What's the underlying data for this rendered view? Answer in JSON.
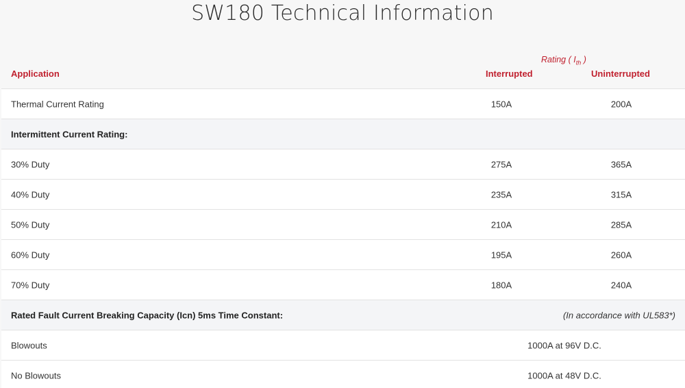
{
  "title": "SW180 Technical Information",
  "header": {
    "rating_prefix": "Rating ( I",
    "rating_sub": "th",
    "rating_suffix": " )",
    "application": "Application",
    "interrupted": "Interrupted",
    "uninterrupted": "Uninterrupted"
  },
  "rows": {
    "thermal": {
      "label": "Thermal Current Rating",
      "interrupted": "150A",
      "uninterrupted": "200A"
    },
    "intermittent_heading": "Intermittent Current Rating:",
    "duty30": {
      "label": "30% Duty",
      "interrupted": "275A",
      "uninterrupted": "365A"
    },
    "duty40": {
      "label": "40% Duty",
      "interrupted": "235A",
      "uninterrupted": "315A"
    },
    "duty50": {
      "label": "50% Duty",
      "interrupted": "210A",
      "uninterrupted": "285A"
    },
    "duty60": {
      "label": "60% Duty",
      "interrupted": "195A",
      "uninterrupted": "260A"
    },
    "duty70": {
      "label": "70% Duty",
      "interrupted": "180A",
      "uninterrupted": "240A"
    },
    "fault_heading": "Rated Fault Current Breaking Capacity (Icn) 5ms Time Constant:",
    "fault_note": "(In accordance with UL583*)",
    "blowouts": {
      "label": "Blowouts",
      "value": "1000A at 96V D.C."
    },
    "no_blowouts": {
      "label": "No Blowouts",
      "value": "1000A at 48V D.C."
    }
  },
  "colors": {
    "accent": "#c0212f",
    "text": "#333333",
    "row_bg": "#ffffff",
    "section_bg": "#f4f5f7",
    "page_bg": "#f7f7f7"
  }
}
